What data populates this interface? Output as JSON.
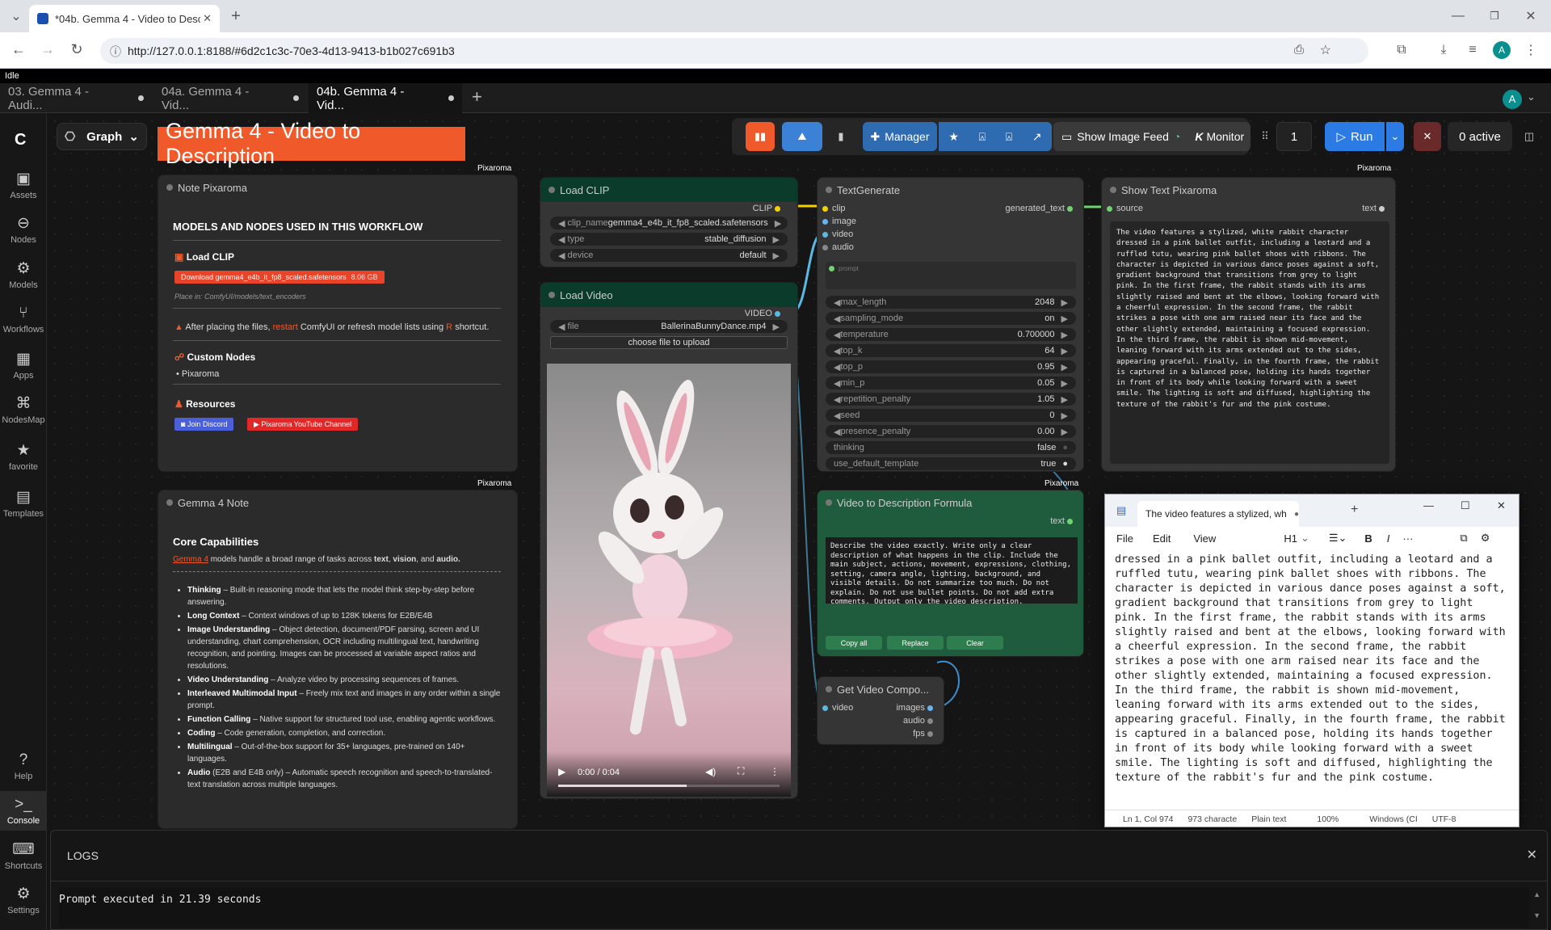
{
  "browser": {
    "tab_title": "*04b. Gemma 4 - Video to Desc",
    "url": "http://127.0.0.1:8188/#6d2c1c3c-70e3-4d13-9413-b1b027c691b3",
    "avatar": "A"
  },
  "status": "Idle",
  "workflow_tabs": [
    {
      "label": "03. Gemma 4 - Audi..."
    },
    {
      "label": "04a. Gemma 4 - Vid..."
    },
    {
      "label": "04b. Gemma 4 - Vid..."
    }
  ],
  "toolbar": {
    "graph": "Graph",
    "title": "Gemma 4 - Video to Description",
    "manager": "Manager",
    "show_feed": "Show Image Feed",
    "monitor": "Monitor",
    "queue_count": "1",
    "run": "Run",
    "active": "0 active",
    "avatar": "A"
  },
  "sidebar": [
    {
      "label": "Assets",
      "icon": "image-icon"
    },
    {
      "label": "Nodes",
      "icon": "nodes-icon"
    },
    {
      "label": "Models",
      "icon": "models-icon"
    },
    {
      "label": "Workflows",
      "icon": "workflows-icon"
    },
    {
      "label": "Apps",
      "icon": "apps-icon"
    },
    {
      "label": "NodesMap",
      "icon": "map-icon"
    },
    {
      "label": "favorite",
      "icon": "star-icon"
    },
    {
      "label": "Templates",
      "icon": "templates-icon"
    },
    {
      "label": "Help",
      "icon": "help-icon"
    },
    {
      "label": "Console",
      "icon": "console-icon"
    },
    {
      "label": "Shortcuts",
      "icon": "keyboard-icon"
    },
    {
      "label": "Settings",
      "icon": "gear-icon"
    }
  ],
  "pixaroma": "Pixaroma",
  "note": {
    "title": "Note Pixaroma",
    "heading": "MODELS AND NODES USED IN THIS WORKFLOW",
    "load_clip": "Load CLIP",
    "download": "Download gemma4_e4b_it_fp8_scaled.safetensors",
    "size": "8.06 GB",
    "place_in": "Place in: ComfyUI/models/text_encoders",
    "warn_pre": "After placing the files,",
    "restart": "restart",
    "warn_mid": "ComfyUI or refresh model lists using",
    "r_key": "R",
    "warn_post": "shortcut.",
    "custom_nodes": "Custom Nodes",
    "custom_item": "Pixaroma",
    "resources": "Resources",
    "discord": "Join Discord",
    "youtube": "Pixaroma YouTube Channel"
  },
  "gemma_note": {
    "title": "Gemma 4 Note",
    "heading": "Core Capabilities",
    "intro_link": "Gemma 4",
    "intro_pre": "models handle a broad range of tasks across",
    "text": "text",
    "vision": "vision",
    "and": "and",
    "audio": "audio.",
    "items": [
      {
        "b": "Thinking",
        "t": "– Built-in reasoning mode that lets the model think step-by-step before answering."
      },
      {
        "b": "Long Context",
        "t": "– Context windows of up to 128K tokens for E2B/E4B"
      },
      {
        "b": "Image Understanding",
        "t": "– Object detection, document/PDF parsing, screen and UI understanding, chart comprehension, OCR including multilingual text, handwriting recognition, and pointing. Images can be processed at variable aspect ratios and resolutions."
      },
      {
        "b": "Video Understanding",
        "t": "– Analyze video by processing sequences of frames."
      },
      {
        "b": "Interleaved Multimodal Input",
        "t": "– Freely mix text and images in any order within a single prompt."
      },
      {
        "b": "Function Calling",
        "t": "– Native support for structured tool use, enabling agentic workflows."
      },
      {
        "b": "Coding",
        "t": "– Code generation, completion, and correction."
      },
      {
        "b": "Multilingual",
        "t": "– Out-of-the-box support for 35+ languages, pre-trained on 140+ languages."
      },
      {
        "b": "Audio",
        "t": "(E2B and E4B only) – Automatic speech recognition and speech-to-translated-text translation across multiple languages."
      }
    ]
  },
  "load_clip": {
    "title": "Load CLIP",
    "out": "CLIP",
    "clip_name": {
      "k": "clip_name",
      "v": "gemma4_e4b_it_fp8_scaled.safetensors"
    },
    "type": {
      "k": "type",
      "v": "stable_diffusion"
    },
    "device": {
      "k": "device",
      "v": "default"
    }
  },
  "load_video": {
    "title": "Load Video",
    "out": "VIDEO",
    "file": {
      "k": "file",
      "v": "BallerinaBunnyDance.mp4"
    },
    "upload": "choose file to upload",
    "time": "0:00 / 0:04"
  },
  "textgen": {
    "title": "TextGenerate",
    "inputs": [
      "clip",
      "image",
      "video",
      "audio"
    ],
    "output": "generated_text",
    "prompt_label": "prompt",
    "widgets": [
      {
        "k": "max_length",
        "v": "2048"
      },
      {
        "k": "sampling_mode",
        "v": "on"
      },
      {
        "k": "temperature",
        "v": "0.700000"
      },
      {
        "k": "top_k",
        "v": "64"
      },
      {
        "k": "top_p",
        "v": "0.95"
      },
      {
        "k": "min_p",
        "v": "0.05"
      },
      {
        "k": "repetition_penalty",
        "v": "1.05"
      },
      {
        "k": "seed",
        "v": "0"
      },
      {
        "k": "presence_penalty",
        "v": "0.00"
      },
      {
        "k": "thinking",
        "v": "false"
      },
      {
        "k": "use_default_template",
        "v": "true"
      }
    ]
  },
  "show_text": {
    "title": "Show Text Pixaroma",
    "in": "source",
    "out": "text",
    "content": "The video features a stylized, white rabbit character dressed in a pink ballet outfit, including a leotard and a ruffled tutu, wearing pink ballet shoes with ribbons. The character is depicted in various dance poses against a soft, gradient background that transitions from grey to light pink. In the first frame, the rabbit stands with its arms slightly raised and bent at the elbows, looking forward with a cheerful expression. In the second frame, the rabbit strikes a pose with one arm raised near its face and the other slightly extended, maintaining a focused expression. In the third frame, the rabbit is shown mid-movement, leaning forward with its arms extended out to the sides, appearing graceful. Finally, in the fourth frame, the rabbit is captured in a balanced pose, holding its hands together in front of its body while looking forward with a sweet smile. The lighting is soft and diffused, highlighting the texture of the rabbit's fur and the pink costume."
  },
  "formula": {
    "title": "Video to Description Formula",
    "out": "text",
    "content": "Describe the video exactly. Write only a clear description of what happens in the clip. Include the main subject, actions, movement, expressions, clothing, setting, camera angle, lighting, background, and visible details. Do not summarize too much. Do not explain. Do not use bullet points. Do not add extra comments. Output only the video description.",
    "copy": "Copy all",
    "replace": "Replace",
    "clear": "Clear"
  },
  "getvideo": {
    "title": "Get Video Compo...",
    "in": "video",
    "outs": [
      "images",
      "audio",
      "fps"
    ]
  },
  "notepad": {
    "tab": "The video features a stylized, whit",
    "menu": [
      "File",
      "Edit",
      "View"
    ],
    "h1": "H1",
    "content": "dressed in a pink ballet outfit, including a leotard and a ruffled tutu, wearing pink ballet shoes with ribbons. The character is depicted in various dance poses against a soft, gradient background that transitions from grey to light pink. In the first frame, the rabbit stands with its arms slightly raised and bent at the elbows, looking forward with a cheerful expression. In the second frame, the rabbit strikes a pose with one arm raised near its face and the other slightly extended, maintaining a focused expression. In the third frame, the rabbit is shown mid-movement, leaning forward with its arms extended out to the sides, appearing graceful. Finally, in the fourth frame, the rabbit is captured in a balanced pose, holding its hands together in front of its body while looking forward with a sweet smile. The lighting is soft and diffused, highlighting the texture of the rabbit's fur and the pink costume.",
    "status": [
      "Ln 1, Col 974",
      "973 characte",
      "Plain text",
      "100%",
      "Windows (CI",
      "UTF-8"
    ]
  },
  "logs": {
    "title": "LOGS",
    "line": "Prompt executed in 21.39 seconds"
  }
}
